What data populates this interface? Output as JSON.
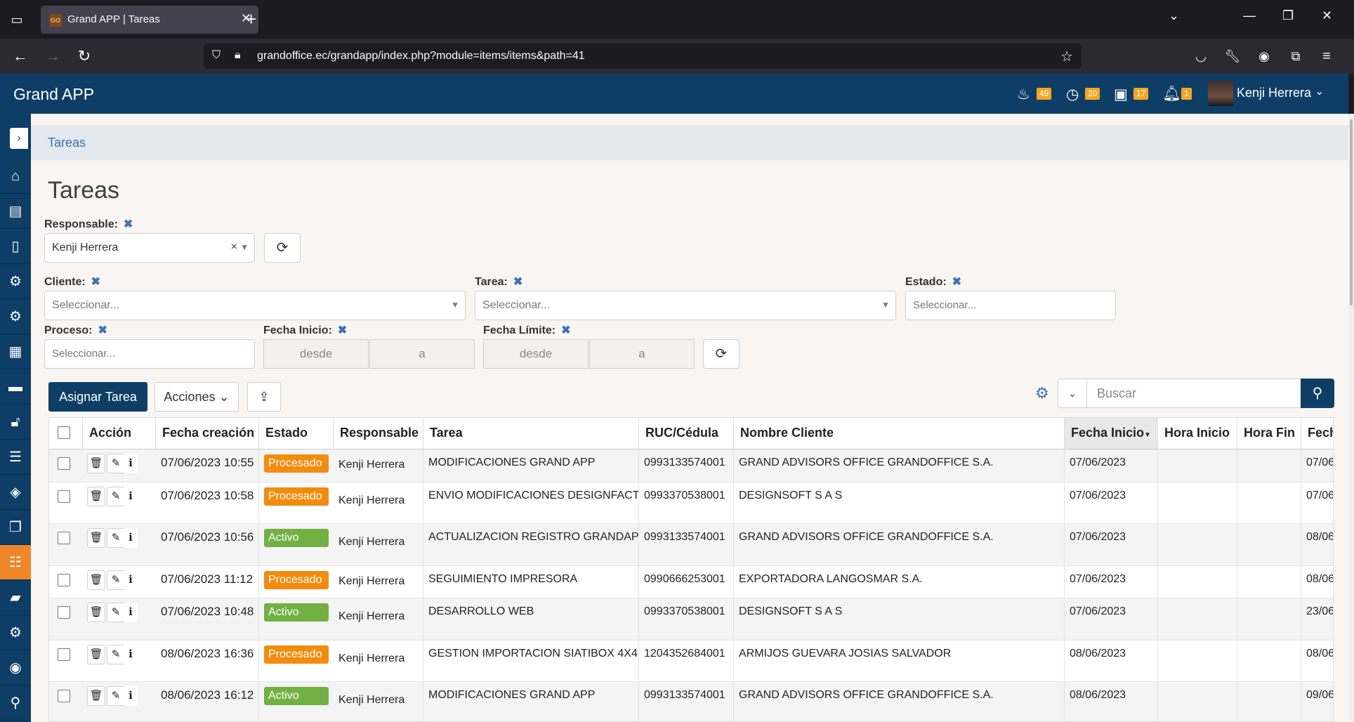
{
  "browser": {
    "tab_title": "Grand APP | Tareas",
    "favicon_text": "GO",
    "url": "grandoffice.ec/grandapp/index.php?module=items/items&path=41"
  },
  "header": {
    "brand": "Grand APP",
    "badges": [
      {
        "icon": "birthday-cake-icon",
        "count": "49"
      },
      {
        "icon": "clock-icon",
        "count": "20"
      },
      {
        "icon": "suitcase-icon",
        "count": "17"
      },
      {
        "icon": "bell-icon",
        "count": "1"
      }
    ],
    "user_name": "Kenji Herrera"
  },
  "sidebar": {
    "items": [
      {
        "icon": "home-icon"
      },
      {
        "icon": "id-card-icon"
      },
      {
        "icon": "document-icon"
      },
      {
        "icon": "cogs-icon"
      },
      {
        "icon": "cogs-icon"
      },
      {
        "icon": "contact-book-icon"
      },
      {
        "icon": "folder-icon"
      },
      {
        "icon": "unlock-icon"
      },
      {
        "icon": "database-icon"
      },
      {
        "icon": "cube-icon"
      },
      {
        "icon": "copy-icon"
      },
      {
        "icon": "tasks-icon",
        "active": true
      },
      {
        "icon": "book-icon"
      },
      {
        "icon": "cogs-icon"
      },
      {
        "icon": "user-circle-icon"
      },
      {
        "icon": "pin-icon"
      }
    ]
  },
  "breadcrumb": "Tareas",
  "page_title": "Tareas",
  "filters": {
    "responsable_label": "Responsable:",
    "responsable_value": "Kenji Herrera",
    "cliente_label": "Cliente:",
    "cliente_placeholder": "Seleccionar...",
    "tarea_label": "Tarea:",
    "tarea_placeholder": "Seleccionar...",
    "estado_label": "Estado:",
    "estado_placeholder": "Seleccionar...",
    "proceso_label": "Proceso:",
    "proceso_placeholder": "Seleccionar...",
    "fecha_inicio_label": "Fecha Inicio:",
    "fecha_limite_label": "Fecha Límite:",
    "desde": "desde",
    "a": "a"
  },
  "toolbar": {
    "assign_label": "Asignar Tarea",
    "actions_label": "Acciones",
    "search_placeholder": "Buscar"
  },
  "table": {
    "headers": [
      "Acción",
      "Fecha creación",
      "Estado",
      "Responsable",
      "Tarea",
      "RUC/Cédula",
      "Nombre Cliente",
      "Fecha Inicio",
      "Hora Inicio",
      "Hora Fin",
      "Fech"
    ],
    "rows": [
      {
        "created": "07/06/2023 10:55",
        "status": "Procesado",
        "resp": "Kenji Herrera",
        "task": "MODIFICACIONES GRAND APP",
        "ruc": "0993133574001",
        "client": "GRAND ADVISORS OFFICE GRANDOFFICE S.A.",
        "start": "07/06/2023",
        "hstart": "",
        "hend": "",
        "limit": "07/06"
      },
      {
        "created": "07/06/2023 10:58",
        "status": "Procesado",
        "resp": "Kenji Herrera",
        "task": "ENVIO MODIFICACIONES DESIGNFACT",
        "ruc": "0993370538001",
        "client": "DESIGNSOFT S A S",
        "start": "07/06/2023",
        "hstart": "",
        "hend": "",
        "limit": "07/06"
      },
      {
        "created": "07/06/2023 10:56",
        "status": "Activo",
        "resp": "Kenji Herrera",
        "task": "ACTUALIZACION REGISTRO GRANDAPP",
        "ruc": "0993133574001",
        "client": "GRAND ADVISORS OFFICE GRANDOFFICE S.A.",
        "start": "07/06/2023",
        "hstart": "",
        "hend": "",
        "limit": "08/06"
      },
      {
        "created": "07/06/2023 11:12",
        "status": "Procesado",
        "resp": "Kenji Herrera",
        "task": "SEGUIMIENTO IMPRESORA",
        "ruc": "0990666253001",
        "client": "EXPORTADORA LANGOSMAR S.A.",
        "start": "07/06/2023",
        "hstart": "",
        "hend": "",
        "limit": "08/06"
      },
      {
        "created": "07/06/2023 10:48",
        "status": "Activo",
        "resp": "Kenji Herrera",
        "task": "DESARROLLO WEB",
        "ruc": "0993370538001",
        "client": "DESIGNSOFT S A S",
        "start": "07/06/2023",
        "hstart": "",
        "hend": "",
        "limit": "23/06"
      },
      {
        "created": "08/06/2023 16:36",
        "status": "Procesado",
        "resp": "Kenji Herrera",
        "task": "GESTION IMPORTACION SIATIBOX 4X4",
        "ruc": "1204352684001",
        "client": "ARMIJOS GUEVARA JOSIAS SALVADOR",
        "start": "08/06/2023",
        "hstart": "",
        "hend": "",
        "limit": "08/06"
      },
      {
        "created": "08/06/2023 16:12",
        "status": "Activo",
        "resp": "Kenji Herrera",
        "task": "MODIFICACIONES GRAND APP",
        "ruc": "0993133574001",
        "client": "GRAND ADVISORS OFFICE GRANDOFFICE S.A.",
        "start": "08/06/2023",
        "hstart": "",
        "hend": "",
        "limit": "09/06"
      }
    ]
  },
  "colors": {
    "brand_navy": "#0e3e66",
    "status_procesado": "#f28c0f",
    "status_activo": "#72b043",
    "sidebar_active": "#f0862a"
  }
}
